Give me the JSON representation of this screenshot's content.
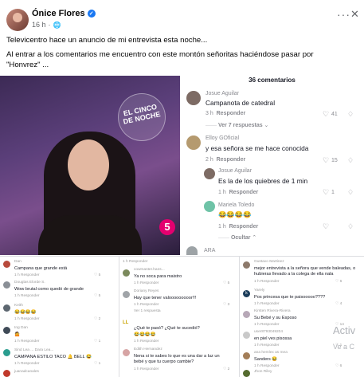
{
  "post": {
    "author": "Ónice Flores",
    "time": "16 h",
    "line1": "Televicentro hace un anuncio de mi entrevista esta noche...",
    "line2a": "Al entrar a los comentarios me encuentro con este montón señoritas haciéndose pasar por",
    "line2b": "\"Honvrez\" ..."
  },
  "image": {
    "logo_line1": "EL CINCO",
    "logo_line2": "DE NOCHE",
    "channel": "5"
  },
  "comments_panel": {
    "title": "36 comentarios",
    "reply": "Responder",
    "view_replies": "Ver 7 respuestas",
    "hide": "Ocultar",
    "items": [
      {
        "name": "Josue Aguilar",
        "text": "Campanota de catedral",
        "time": "3 h",
        "likes": "41"
      },
      {
        "name": "Elloy GOficial",
        "text": "y esa señora se me hace conocida",
        "time": "2 h",
        "likes": "15"
      },
      {
        "name": "Josue Aguilar",
        "text": "Es la de los quiebres de 1 min",
        "time": "1 h",
        "likes": "1"
      },
      {
        "name": "Mariela Toledo",
        "text": "😂😂😂😂",
        "time": "1 h",
        "likes": ""
      },
      {
        "name": "ARA",
        "text": "",
        "time": "",
        "likes": ""
      }
    ]
  },
  "collage": {
    "left": [
      {
        "name": "Dan",
        "text": "Campana que grande está",
        "meta": "1 h  Responder",
        "likes": "5"
      },
      {
        "name": "Douglas Elorde S.",
        "text": "Wow brutal como quedó de grande",
        "meta": "1 h  Responder",
        "likes": "5"
      },
      {
        "name": "Keith",
        "text": "😂😂😂😂",
        "meta": "1 h  Responder",
        "likes": "2"
      },
      {
        "name": "Ing Dan",
        "text": "🤷",
        "meta": "1 h  Responder",
        "likes": "1"
      },
      {
        "name": "Sind Lea ... Dara Lea...",
        "text": "CAMPANA ESTILO TACO 🔔 BELL 😂",
        "meta": "1 h  Responder",
        "likes": "1"
      },
      {
        "name": "juanadcanales",
        "text": "",
        "meta": "",
        "likes": ""
      }
    ],
    "middle": [
      {
        "name": "cowmaster.hans...",
        "text": "Ya no soca para maistro",
        "meta": "1 h  Responder",
        "likes": "5"
      },
      {
        "name": "Doriany Reyes",
        "text": "Hay que tener valooooooooor!!!",
        "meta": "1 h  Responder",
        "likes": "3"
      },
      {
        "name": "LL",
        "text": "¿Qué te pasó? ¿Qué te sucedió?",
        "meta": "1 h  Responder",
        "likes": ""
      },
      {
        "name": "Edith Hernandez",
        "text": "Nena si te sabes lo que es una dar a luz un bebé y que tu cuerpo cambie?",
        "meta": "1 h  Responder",
        "likes": "2"
      }
    ],
    "middle_emoji": "😂😂😂😂",
    "view_reply": "Ver 1 respuesta",
    "right": [
      {
        "name": "Gustavo Martinez",
        "text": "mejor entrevista a la señora que vende baleadas, o hubieras llevado a la colega de ella nala",
        "meta": "1 h  Responder",
        "likes": "6"
      },
      {
        "name": "Yarely",
        "text": "Pos princesa que te paisooooo????",
        "meta": "1 h  Responder",
        "likes": "4"
      },
      {
        "name": "Kirsten Rivera-Rivera",
        "text": "Su Bebé y su Esposo",
        "meta": "1 h  Responder",
        "likes": "14"
      },
      {
        "name": "user8793049204",
        "text": "en piel ves pisossa",
        "meta": "1 h  Responder",
        "likes": "1"
      },
      {
        "name": "ana hemlex as mea",
        "text": "Sanders 😂",
        "meta": "1 h  Responder",
        "likes": "6"
      },
      {
        "name": "Jhon Riley",
        "text": "",
        "meta": "",
        "likes": ""
      }
    ]
  },
  "watermark": {
    "line1": "Activ",
    "line2": "Ve a C"
  },
  "colors": {
    "accent": "#1877f2",
    "brand_pink": "#e4006f"
  }
}
